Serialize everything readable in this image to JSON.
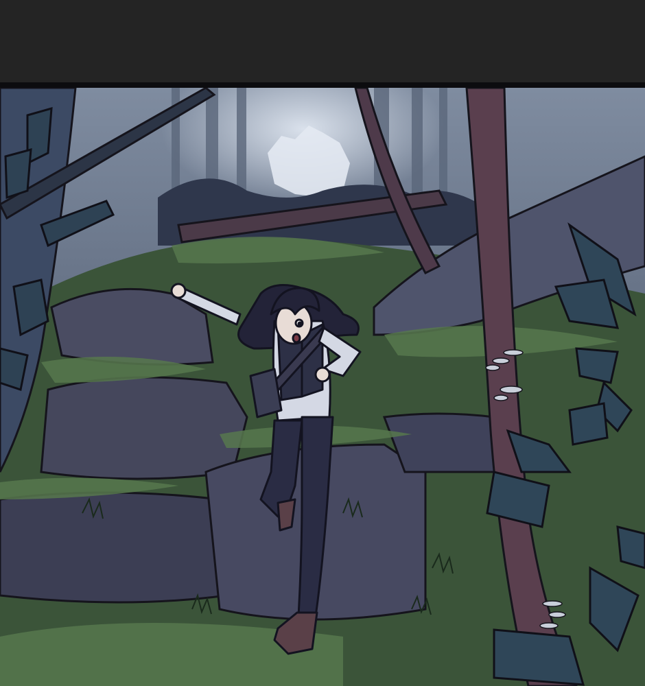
{
  "viewer": {
    "background_color": "#242424",
    "border_color": "#0c0c0f"
  },
  "panel": {
    "palette": {
      "sky_mist": "#a8b4c4",
      "far_trees": "#4a566a",
      "mid_forest": "#2c3448",
      "moss": "#3e5a3c",
      "moss_light": "#57784e",
      "rock": "#4a4c62",
      "rock_dark": "#33354a",
      "trunk": "#4e3a4a",
      "leaf": "#2f4456",
      "hair": "#232338",
      "shirt": "#d4d8e4",
      "pants": "#2a2c44",
      "skin": "#e8dcd6"
    },
    "icons": [
      "girl-figure-icon",
      "tree-trunk-icon",
      "leaf-cluster-icon",
      "mushroom-cluster-icon",
      "rock-ledge-icon"
    ]
  }
}
